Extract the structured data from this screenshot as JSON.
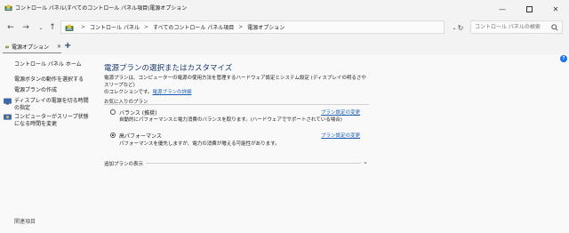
{
  "window": {
    "title": "コントロール パネル\\すべてのコントロール パネル項目\\電源オプション",
    "controls": [
      "minimize",
      "maximize",
      "close"
    ]
  },
  "address": {
    "segments": [
      "コントロール パネル",
      "すべてのコントロール パネル項目",
      "電源オプション"
    ]
  },
  "search": {
    "placeholder": "コントロール パネルの検索"
  },
  "tab": {
    "label": "電源オプション",
    "add": "+"
  },
  "sidebar": {
    "home": "コントロール パネル ホーム",
    "items": [
      "電源ボタンの動作を選択する",
      "電源プランの作成",
      "ディスプレイの電源を切る時間の指定",
      "コンピューターがスリープ状態になる時間を変更"
    ],
    "see_also": "関連項目"
  },
  "main": {
    "title": "電源プランの選択またはカスタマイズ",
    "desc_line1": "電源プランは、コンピューターの電源の使用方法を管理するハードウェア設定とシステム設定 (ディスプレイの明るさやスリープなど)",
    "desc_line2": "のコレクションです。",
    "desc_link": "電源プランの詳細",
    "group_label": "お気に入りのプラン",
    "plans": [
      {
        "name": "バランス (推奨)",
        "desc": "自動的にパフォーマンスと電力消費のバランスを取ります。(ハードウェアでサポートされている場合)",
        "link": "プラン設定の変更",
        "selected": false
      },
      {
        "name": "高パフォーマンス",
        "desc": "パフォーマンスを優先しますが、電力の消費が増える可能性があります。",
        "link": "プラン設定の変更",
        "selected": true
      }
    ],
    "additional": "追加プランの表示"
  },
  "colors": {
    "link": "#1a5fb4",
    "title": "#1a3a6e",
    "help": "#1a73e8"
  }
}
